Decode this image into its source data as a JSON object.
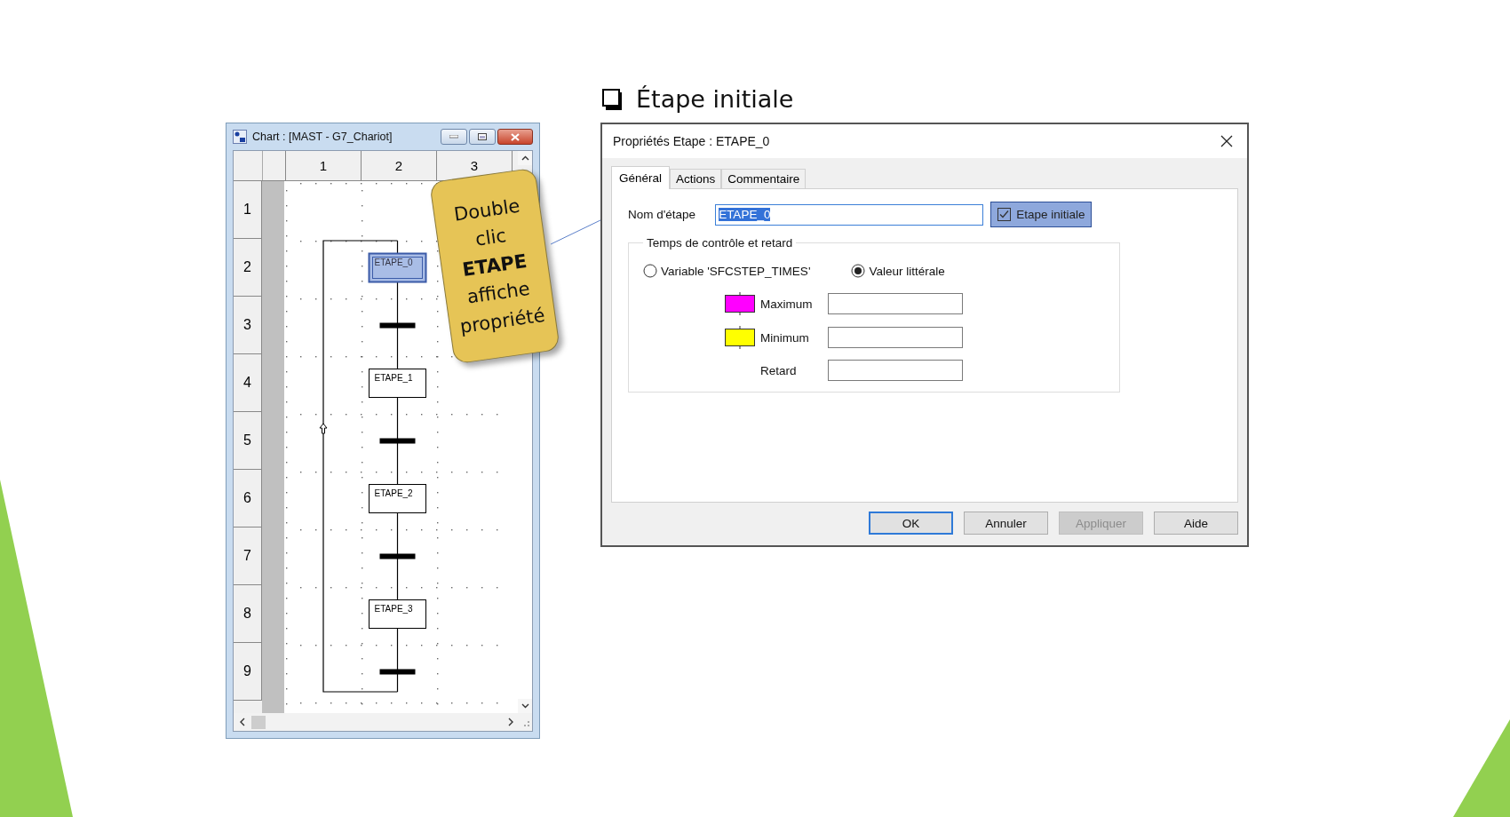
{
  "slide": {
    "heading": "Étape initiale"
  },
  "chart_window": {
    "title": "Chart : [MAST - G7_Chariot]",
    "columns": [
      "1",
      "2",
      "3"
    ],
    "rows": [
      "1",
      "2",
      "3",
      "4",
      "5",
      "6",
      "7",
      "8",
      "9"
    ],
    "steps": [
      {
        "label": "ETAPE_0",
        "initial": true,
        "selected": true
      },
      {
        "label": "ETAPE_1",
        "initial": false,
        "selected": false
      },
      {
        "label": "ETAPE_2",
        "initial": false,
        "selected": false
      },
      {
        "label": "ETAPE_3",
        "initial": false,
        "selected": false
      }
    ]
  },
  "callout": {
    "text": "Double clic **ETAPE** affiche propriété"
  },
  "dialog": {
    "title": "Propriétés Etape : ETAPE_0",
    "tabs": [
      {
        "label": "Général",
        "selected": true
      },
      {
        "label": "Actions",
        "selected": false
      },
      {
        "label": "Commentaire",
        "selected": false
      }
    ],
    "step_name": {
      "label": "Nom d'étape",
      "value": "ETAPE_0",
      "text_selected": true
    },
    "initial_step": {
      "label": "Etape initiale",
      "checked": true,
      "highlighted": true
    },
    "group": {
      "title": "Temps de contrôle et retard",
      "radios": [
        {
          "label": "Variable 'SFCSTEP_TIMES'",
          "selected": false
        },
        {
          "label": "Valeur littérale",
          "selected": true
        }
      ],
      "fields": [
        {
          "label": "Maximum",
          "color": "#ff00ff"
        },
        {
          "label": "Minimum",
          "color": "#ffff00"
        },
        {
          "label": "Retard"
        }
      ]
    },
    "buttons": [
      {
        "label": "OK",
        "default": true,
        "disabled": false
      },
      {
        "label": "Annuler",
        "default": false,
        "disabled": false
      },
      {
        "label": "Appliquer",
        "default": false,
        "disabled": true
      },
      {
        "label": "Aide",
        "default": false,
        "disabled": false
      }
    ]
  }
}
